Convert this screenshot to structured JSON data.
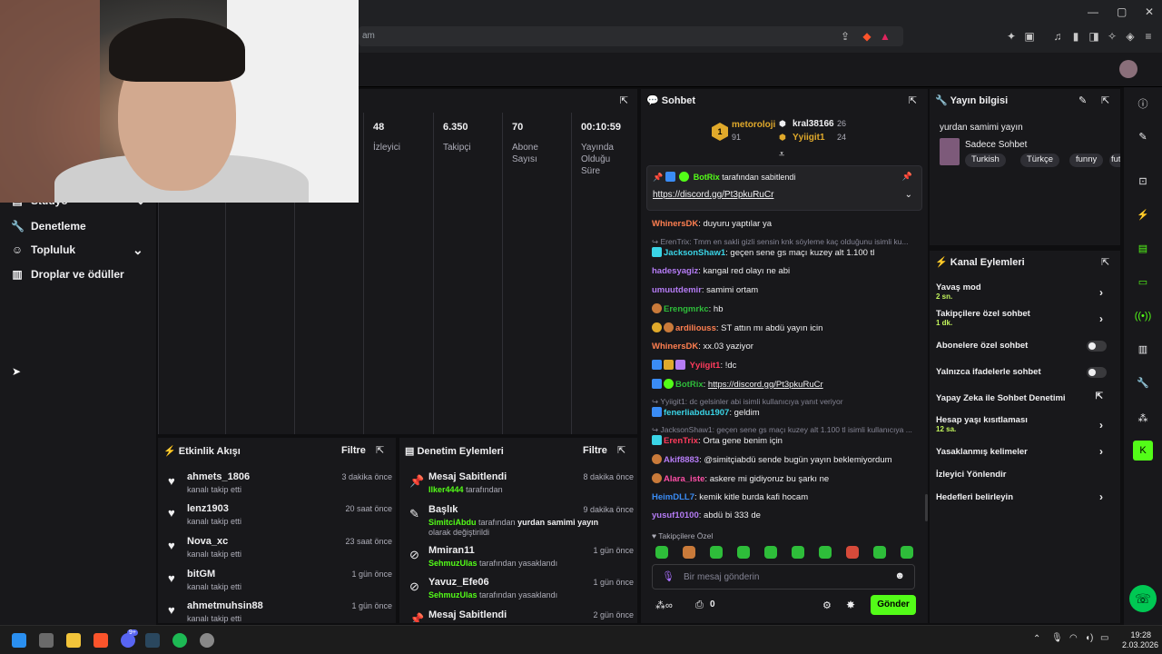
{
  "browser": {
    "address_fragment": "am",
    "window_controls": [
      "—",
      "▢",
      "✕"
    ]
  },
  "sidebar": {
    "items": [
      {
        "label": "Stüdyo",
        "icon": "studio-icon",
        "has_chevron": true
      },
      {
        "label": "Denetleme",
        "icon": "wrench-icon",
        "has_chevron": false
      },
      {
        "label": "Topluluk",
        "icon": "community-icon",
        "has_chevron": true
      },
      {
        "label": "Droplar ve ödüller",
        "icon": "drops-icon",
        "has_chevron": false
      }
    ]
  },
  "stats": [
    {
      "value": "48",
      "label": "İzleyici"
    },
    {
      "value": "6.350",
      "label": "Takipçi"
    },
    {
      "value": "70",
      "label": "Abone Sayısı"
    },
    {
      "value": "00:10:59",
      "label": "Yayında Olduğu Süre"
    }
  ],
  "activity": {
    "title": "Etkinlik Akışı",
    "filter": "Filtre",
    "rows": [
      {
        "name": "ahmets_1806",
        "sub": "kanalı takip etti",
        "time": "3 dakika önce"
      },
      {
        "name": "lenz1903",
        "sub": "kanalı takip etti",
        "time": "20 saat önce"
      },
      {
        "name": "Nova_xc",
        "sub": "kanalı takip etti",
        "time": "23 saat önce"
      },
      {
        "name": "bitGM",
        "sub": "kanalı takip etti",
        "time": "1 gün önce"
      },
      {
        "name": "ahmetmuhsin88",
        "sub": "kanalı takip etti",
        "time": "1 gün önce"
      }
    ]
  },
  "moderation": {
    "title": "Denetim Eylemleri",
    "filter": "Filtre",
    "rows": [
      {
        "name": "Mesaj Sabitlendi",
        "actor": "Ilker4444",
        "rest": "tarafından",
        "time": "8 dakika önce",
        "icon": "pin-icon"
      },
      {
        "name": "Başlık",
        "actor": "SimitciAbdu",
        "rest": "tarafından",
        "bold": "yurdan samimi yayın",
        "rest2": "olarak değiştirildi",
        "time": "9 dakika önce",
        "icon": "title-edit-icon"
      },
      {
        "name": "Mmiran11",
        "actor": "SehmuzUlas",
        "rest": "tarafından yasaklandı",
        "time": "1 gün önce",
        "icon": "ban-icon"
      },
      {
        "name": "Yavuz_Efe06",
        "actor": "SehmuzUlas",
        "rest": "tarafından yasaklandı",
        "time": "1 gün önce",
        "icon": "ban-icon"
      },
      {
        "name": "Mesaj Sabitlendi",
        "actor": "",
        "rest": "",
        "time": "2 gün önce",
        "icon": "pin-icon"
      }
    ]
  },
  "chat": {
    "title": "Sohbet",
    "leaders": [
      {
        "name": "metoroloji",
        "score": "91",
        "rank": "1"
      },
      {
        "name": "kral38166",
        "score": "26"
      },
      {
        "name": "Yyiigit1",
        "score": "24"
      }
    ],
    "pinned": {
      "by": "BotRix",
      "by_text": "tarafından sabitlendi",
      "link": "https://discord.gg/Pt3pkuRuCr"
    },
    "messages": [
      {
        "type": "msg",
        "user": "WhinersDK",
        "color": "#ff7f50",
        "text": "duyuru yaptılar ya"
      },
      {
        "type": "reply",
        "text": "ErenTrix: Tmm en sakli gizli sensin knk söyleme kaç olduğunu isimli ku..."
      },
      {
        "type": "msg",
        "user": "JacksonShaw1",
        "color": "#3ad4e6",
        "text": "geçen sene gs maçı kuzey alt 1.100 tl"
      },
      {
        "type": "msg",
        "user": "hadesyagiz",
        "color": "#b57cf5",
        "text": "kangal red olayı ne abi"
      },
      {
        "type": "msg",
        "user": "umuutdemir",
        "color": "#b57cf5",
        "text": "samimi ortam"
      },
      {
        "type": "msg",
        "user": "Erengmrkc",
        "color": "#2ebd3a",
        "text": "hb"
      },
      {
        "type": "msg",
        "user": "ardiliouss",
        "color": "#ff7f50",
        "text": "ST attın mı abdü yayın icin"
      },
      {
        "type": "msg",
        "user": "WhinersDK",
        "color": "#ff7f50",
        "text": "xx.03 yaziyor"
      },
      {
        "type": "msg",
        "user": "Yyiigit1",
        "color": "#ff3b5c",
        "text": "!dc"
      },
      {
        "type": "msg",
        "user": "BotRix",
        "color": "#2ebd3a",
        "text": "https://discord.gg/Pt3pkuRuCr",
        "link": true
      },
      {
        "type": "reply",
        "text": "Yyiigit1: dc gelsinler abi isimli kullanıcıya yanıt veriyor"
      },
      {
        "type": "msg",
        "user": "fenerliabdu1907",
        "color": "#3ad4e6",
        "text": "geldim"
      },
      {
        "type": "reply",
        "text": "JacksonShaw1: geçen sene gs maçı kuzey alt 1.100 tl isimli kullanıcıya ..."
      },
      {
        "type": "msg",
        "user": "ErenTrix",
        "color": "#ff3b5c",
        "text": "Orta gene benim için"
      },
      {
        "type": "msg",
        "user": "Akif8883",
        "color": "#b57cf5",
        "text": "@simitçiabdü sende bugün yayın beklemiyordum"
      },
      {
        "type": "msg",
        "user": "Alara_iste",
        "color": "#ff4fa7",
        "text": "askere mi gidiyoruz bu şarkı ne"
      },
      {
        "type": "msg",
        "user": "HeimDLL7",
        "color": "#3a8cf5",
        "text": "kemik kitle burda kafi hocam"
      },
      {
        "type": "msg",
        "user": "yusuf10100",
        "color": "#b57cf5",
        "text": "abdü bi 333 de"
      }
    ],
    "followers_only": "Takipçilere Özel",
    "input_placeholder": "Bir mesaj gönderin",
    "points": "0",
    "send_label": "Gönder"
  },
  "stream_info": {
    "title": "Yayın bilgisi",
    "stream_title": "yurdan samimi yayın",
    "category": "Sadece Sohbet",
    "tags": [
      "Turkish",
      "Türkçe",
      "funny",
      "futbo"
    ]
  },
  "channel_actions": {
    "title": "Kanal Eylemleri",
    "items": [
      {
        "label": "Yavaş mod",
        "sub": "2 sn.",
        "control": "chevron"
      },
      {
        "label": "Takipçilere özel sohbet",
        "sub": "1 dk.",
        "control": "chevron"
      },
      {
        "label": "Abonelere özel sohbet",
        "sub": "",
        "control": "toggle"
      },
      {
        "label": "Yalnızca ifadelerle sohbet",
        "sub": "",
        "control": "toggle"
      },
      {
        "label": "Yapay Zeka ile Sohbet Denetimi",
        "sub": "",
        "control": "external"
      },
      {
        "label": "Hesap yaşı kısıtlaması",
        "sub": "12 sa.",
        "control": "chevron"
      },
      {
        "label": "Yasaklanmış kelimeler",
        "sub": "",
        "control": "chevron"
      },
      {
        "label": "İzleyici Yönlendir",
        "sub": "",
        "control": "none"
      },
      {
        "label": "Hedefleri belirleyin",
        "sub": "",
        "control": "chevron"
      }
    ]
  },
  "taskbar": {
    "time": "19:28",
    "date": "2.03.2026",
    "notification_badge": "9+"
  },
  "colors": {
    "accent": "#53fc18",
    "panel": "#18181b",
    "background": "#0e0e10"
  }
}
